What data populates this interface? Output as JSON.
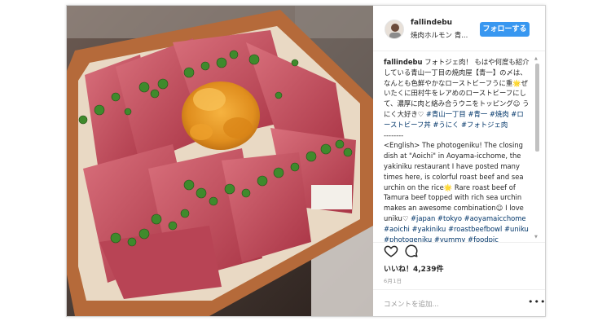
{
  "post": {
    "username": "fallindebu",
    "location": "焼肉ホルモン 青...",
    "follow_label": "フォローする",
    "likes": "いいね！4,239件",
    "date": "6月1日",
    "comment_placeholder": "コメントを追加...",
    "more_label": "•••"
  },
  "caption": {
    "username": "fallindebu",
    "jp_text": "フォトジェ肉！ もはや何度も紹介している青山一丁目の焼肉屋【青一】の〆は、なんとも色鮮やかなローストビーフうに重🌟ぜいたくに田村牛をレアめのローストビーフにして、濃厚に肉と絡み合うウニをトッピング☺ うにく大好き♡",
    "jp_tags": "#青山一丁目 #青一 #焼肉 #ローストビーフ丼 #うにく #フォトジェ肉",
    "separator": "--------",
    "en_text": "<English> The photogeniku! The closing dish at \"Aoichi\" in Aoyama-icchome, the yakiniku restaurant I have posted many times here, is colorful roast beef and sea urchin on the rice🌟 Rare roast beef of Tamura beef topped with rich sea urchin makes an awesome combination☺ I love uniku♡",
    "en_tags": "#japan #tokyo #aoyamaicchome #aoichi #yakiniku #roastbeefbowl #uniku #photogeniku #yummy #foodpic #foodstagram"
  },
  "icons": {
    "heart": "heart-icon",
    "comment": "comment-icon",
    "more": "more-icon"
  },
  "colors": {
    "follow_button": "#3897f0",
    "hashtag": "#003569",
    "muted": "#999999"
  }
}
